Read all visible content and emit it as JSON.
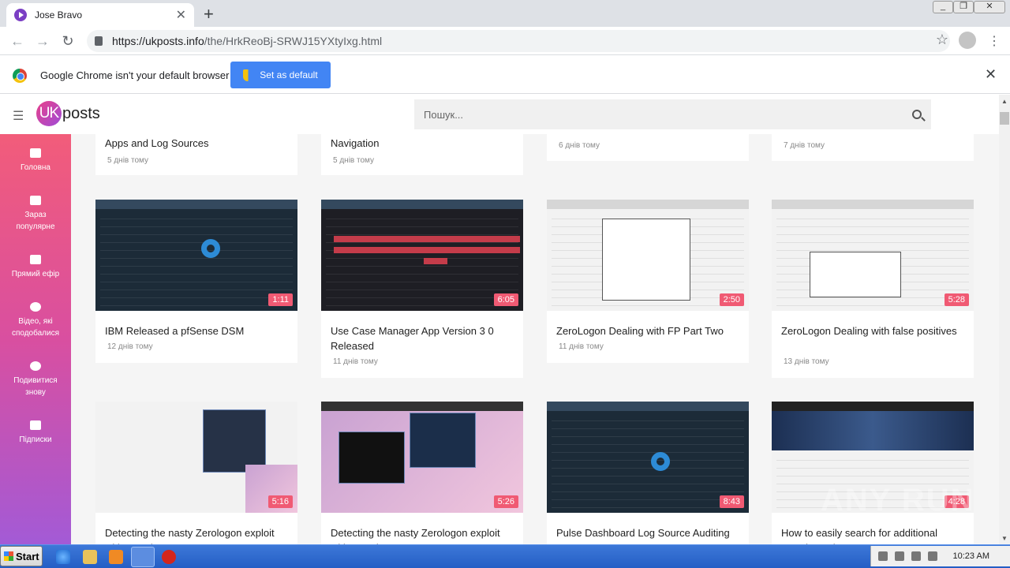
{
  "browser": {
    "tab_title": "Jose Bravo",
    "url_host": "https://ukposts.info",
    "url_path": "/the/HrkReoBj-SRWJ15YXtyIxg.html"
  },
  "infobar": {
    "message": "Google Chrome isn't your default browser",
    "button": "Set as default"
  },
  "site": {
    "logo_uk": "UK",
    "logo_posts": "posts",
    "search_placeholder": "Пошук..."
  },
  "sidebar": {
    "items": [
      {
        "icon": "home-icon",
        "label": "Головна"
      },
      {
        "icon": "fire-icon",
        "label": "Зараз популярне"
      },
      {
        "icon": "live-icon",
        "label": "Прямий ефір"
      },
      {
        "icon": "heart-icon",
        "label": "Відео, які сподобалися"
      },
      {
        "icon": "history-icon",
        "label": "Подивитися знову"
      },
      {
        "icon": "folder-icon",
        "label": "Підписки"
      }
    ]
  },
  "top_cards": [
    {
      "title": "Apps and Log Sources",
      "date": "5 днів тому"
    },
    {
      "title": "Navigation",
      "date": "5 днів тому"
    },
    {
      "title": "",
      "date": "6 днів тому"
    },
    {
      "title": "",
      "date": "7 днів тому"
    }
  ],
  "videos": [
    {
      "title": "IBM Released a pfSense DSM",
      "date": "12 днів тому",
      "duration": "1:11"
    },
    {
      "title": "Use Case Manager App Version 3 0 Released",
      "date": "11 днів тому",
      "duration": "6:05"
    },
    {
      "title": "ZeroLogon Dealing with FP Part Two",
      "date": "11 днів тому",
      "duration": "2:50"
    },
    {
      "title": "ZeroLogon Dealing with false positives",
      "date": "13 днів тому",
      "duration": "5:28"
    },
    {
      "title": "Detecting the nasty Zerologon exploit with QRadar Part Two",
      "duration": "5:16"
    },
    {
      "title": "Detecting the nasty Zerologon exploit with QRadar Part One",
      "duration": "5:26"
    },
    {
      "title": "Pulse Dashboard Log Source Auditing",
      "duration": "8:43"
    },
    {
      "title": "How to easily search for additional QRadar Relp...",
      "duration": "4:28"
    }
  ],
  "taskbar": {
    "start": "Start",
    "clock": "10:23 AM"
  },
  "watermark": "ANY RUN"
}
